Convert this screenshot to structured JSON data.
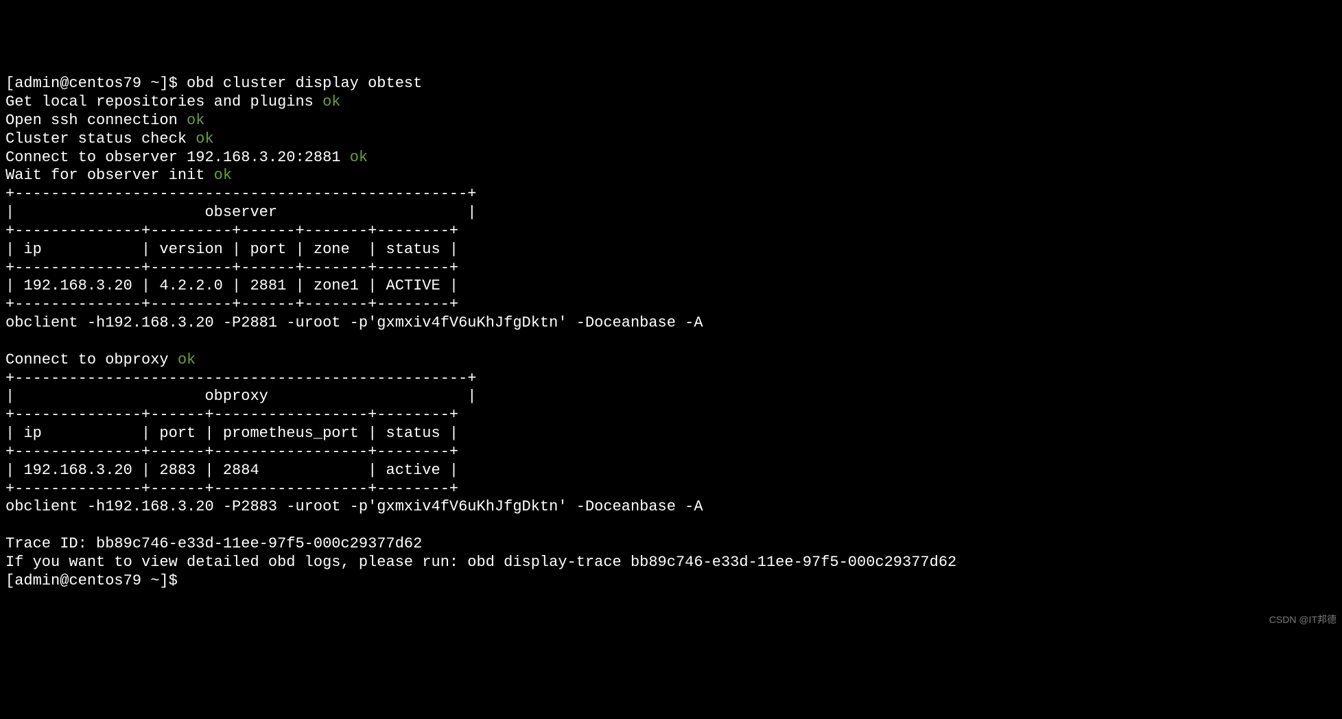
{
  "prompt1": {
    "userhost": "[admin@centos79 ~]$ ",
    "command": "obd cluster display obtest"
  },
  "lines": {
    "l1": "Get local repositories and plugins ",
    "l1ok": "ok",
    "l2": "Open ssh connection ",
    "l2ok": "ok",
    "l3": "Cluster status check ",
    "l3ok": "ok",
    "l4": "Connect to observer 192.168.3.20:2881 ",
    "l4ok": "ok",
    "l5": "Wait for observer init ",
    "l5ok": "ok",
    "t1_border_top": "+--------------------------------------------------+",
    "t1_title": "|                     observer                     |",
    "t1_header_sep": "+--------------+---------+------+-------+--------+",
    "t1_header": "| ip           | version | port | zone  | status |",
    "t1_row1": "| 192.168.3.20 | 4.2.2.0 | 2881 | zone1 | ACTIVE |",
    "obclient1": "obclient -h192.168.3.20 -P2881 -uroot -p'gxmxiv4fV6uKhJfgDktn' -Doceanbase -A",
    "l6": "Connect to obproxy ",
    "l6ok": "ok",
    "t2_border_top": "+--------------------------------------------------+",
    "t2_title": "|                     obproxy                      |",
    "t2_header_sep": "+--------------+------+-----------------+--------+",
    "t2_header": "| ip           | port | prometheus_port | status |",
    "t2_row1": "| 192.168.3.20 | 2883 | 2884            | active |",
    "obclient2": "obclient -h192.168.3.20 -P2883 -uroot -p'gxmxiv4fV6uKhJfgDktn' -Doceanbase -A",
    "trace": "Trace ID: bb89c746-e33d-11ee-97f5-000c29377d62",
    "hint": "If you want to view detailed obd logs, please run: obd display-trace bb89c746-e33d-11ee-97f5-000c29377d62"
  },
  "prompt2": {
    "userhost": "[admin@centos79 ~]$ "
  },
  "watermark": "CSDN @IT邦德"
}
